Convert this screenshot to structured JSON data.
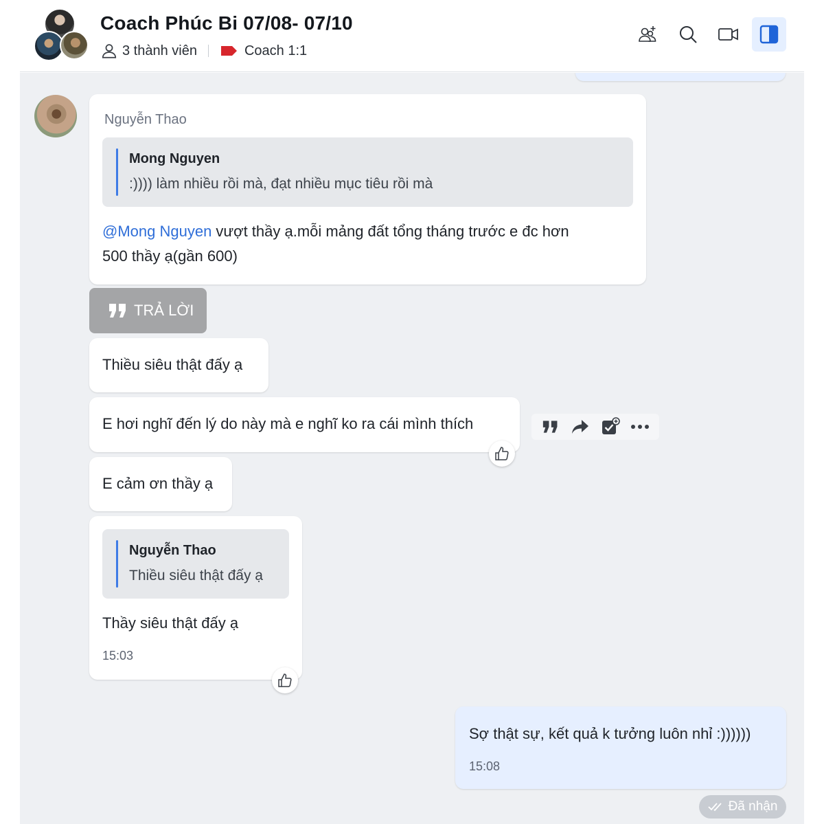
{
  "header": {
    "title": "Coach Phúc Bi 07/08- 07/10",
    "members": "3 thành viên",
    "tag": "Coach 1:1",
    "tag_color": "#d7262c",
    "icons": [
      "add-member-icon",
      "search-icon",
      "video-call-icon",
      "toggle-sidebar-icon"
    ]
  },
  "messages": {
    "first": {
      "sender": "Nguyễn Thao",
      "quote_name": "Mong Nguyen",
      "quote_text": ":)))) làm nhiều rồi mà, đạt nhiều mục tiêu rồi mà",
      "mention": "@Mong Nguyen",
      "text_line1": " vượt thầy ạ.mỗi mảng đất tổng tháng trước e đc hơn",
      "text_line2": "500 thầy ạ(gần 600)"
    },
    "reply_button": "TRẢ LỜI",
    "m2": "Thiều siêu thật đấy ạ",
    "m3": "E hơi nghĩ đến lý do này mà e nghĩ ko ra cái mình thích",
    "m4": "E cảm ơn thầy ạ",
    "m5": {
      "quote_name": "Nguyễn Thao",
      "quote_text": "Thiều siêu thật đấy ạ",
      "text": "Thầy siêu thật đấy ạ",
      "time": "15:03"
    },
    "own": {
      "text": "Sợ thật sự, kết quả k tưởng luôn nhỉ :))))))",
      "time": "15:08",
      "status": "Đã nhận"
    }
  },
  "message_actions": [
    "quote-icon",
    "forward-icon",
    "add-task-icon",
    "more-icon"
  ],
  "colors": {
    "accent": "#2f6ed8",
    "own_bubble": "#e6efff",
    "background": "#eef0f3"
  }
}
